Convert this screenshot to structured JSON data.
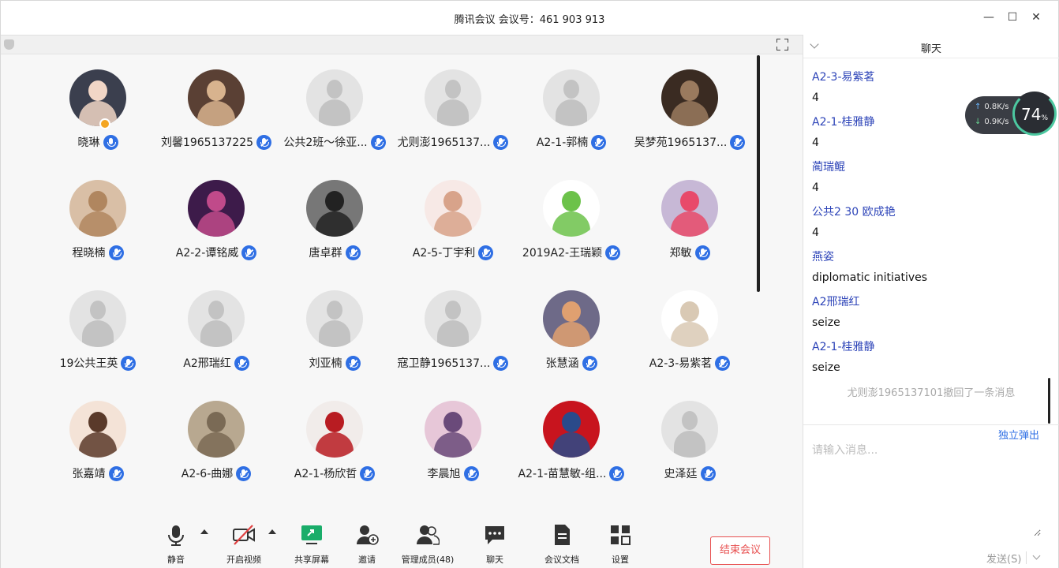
{
  "window": {
    "title": "腾讯会议 会议号：461 903 913",
    "minimize": "—",
    "maximize": "☐",
    "close": "✕"
  },
  "participants": [
    {
      "name": "晓琳",
      "avatar": "photo",
      "colors": [
        "#3b3f4e",
        "#f1d6c6"
      ],
      "host": true
    },
    {
      "name": "刘馨1965137225",
      "avatar": "photo",
      "colors": [
        "#5a4034",
        "#d8b38e"
      ]
    },
    {
      "name": "公共2班～徐亚...",
      "avatar": "default"
    },
    {
      "name": "尤则澎1965137...",
      "avatar": "default"
    },
    {
      "name": "A2-1-郭楠",
      "avatar": "default"
    },
    {
      "name": "吴梦苑1965137...",
      "avatar": "photo",
      "colors": [
        "#3a2b22",
        "#9a7a5e"
      ]
    },
    {
      "name": "程晓楠",
      "avatar": "photo",
      "colors": [
        "#d9bfa6",
        "#b0865f"
      ]
    },
    {
      "name": "A2-2-谭铭威",
      "avatar": "photo",
      "colors": [
        "#3d1b4a",
        "#c04a8a"
      ]
    },
    {
      "name": "唐卓群",
      "avatar": "photo",
      "colors": [
        "#777777",
        "#222222"
      ]
    },
    {
      "name": "A2-5-丁宇利",
      "avatar": "photo",
      "colors": [
        "#f7e9e6",
        "#d8a38a"
      ]
    },
    {
      "name": "2019A2-王瑞颖",
      "avatar": "photo",
      "colors": [
        "#ffffff",
        "#6cc24a"
      ]
    },
    {
      "name": "郑敏",
      "avatar": "photo",
      "colors": [
        "#c7b8d6",
        "#e84a6a"
      ]
    },
    {
      "name": "19公共王英",
      "avatar": "default"
    },
    {
      "name": "A2邢瑞红",
      "avatar": "default"
    },
    {
      "name": "刘亚楠",
      "avatar": "default"
    },
    {
      "name": "寇卫静1965137...",
      "avatar": "default"
    },
    {
      "name": "张慧涵",
      "avatar": "photo",
      "colors": [
        "#6e6a88",
        "#e0a070"
      ]
    },
    {
      "name": "A2-3-易紫茗",
      "avatar": "photo",
      "colors": [
        "#ffffff",
        "#d9c9b4"
      ]
    },
    {
      "name": "张嘉靖",
      "avatar": "photo",
      "colors": [
        "#f4e3d7",
        "#5a3a2a"
      ]
    },
    {
      "name": "A2-6-曲娜",
      "avatar": "photo",
      "colors": [
        "#b8a890",
        "#7a6a55"
      ]
    },
    {
      "name": "A2-1-杨欣哲",
      "avatar": "photo",
      "colors": [
        "#f1ecea",
        "#b81c22"
      ]
    },
    {
      "name": "李晨旭",
      "avatar": "photo",
      "colors": [
        "#e7c7d8",
        "#6a4a7a"
      ]
    },
    {
      "name": "A2-1-苗慧敏-组...",
      "avatar": "photo",
      "colors": [
        "#c8141e",
        "#2a4a8a"
      ]
    },
    {
      "name": "史泽廷",
      "avatar": "default"
    }
  ],
  "toolbar": {
    "mute": "静音",
    "video": "开启视频",
    "share": "共享屏幕",
    "invite": "邀请",
    "members": "管理成员(48)",
    "chat": "聊天",
    "docs": "会议文档",
    "settings": "设置",
    "end": "结束会议"
  },
  "colors": {
    "mic_blue": "#2f6fe4",
    "end_red": "#e85050",
    "share_green": "#1aad6a",
    "sender_blue": "#2d44b8"
  },
  "chat": {
    "title": "聊天",
    "messages": [
      {
        "sender": "A2-3-易紫茗",
        "text": "4"
      },
      {
        "sender": "A2-1-桂雅静",
        "text": "4"
      },
      {
        "sender": "蔺瑞鲲",
        "text": "4"
      },
      {
        "sender": "公共2 30 欧成艳",
        "text": "4"
      },
      {
        "sender": "燕姿",
        "text": "diplomatic initiatives"
      },
      {
        "sender": "A2邢瑞红",
        "text": "seize"
      },
      {
        "sender": "A2-1-桂雅静",
        "text": "seize"
      }
    ],
    "system_notice": "尤则澎1965137101撤回了一条消息",
    "popout": "独立弹出",
    "input_placeholder": "请输入消息...",
    "send": "发送(S)"
  },
  "network": {
    "up": "0.8K/s",
    "down": "0.9K/s",
    "percent": "74",
    "percent_sign": "%"
  }
}
